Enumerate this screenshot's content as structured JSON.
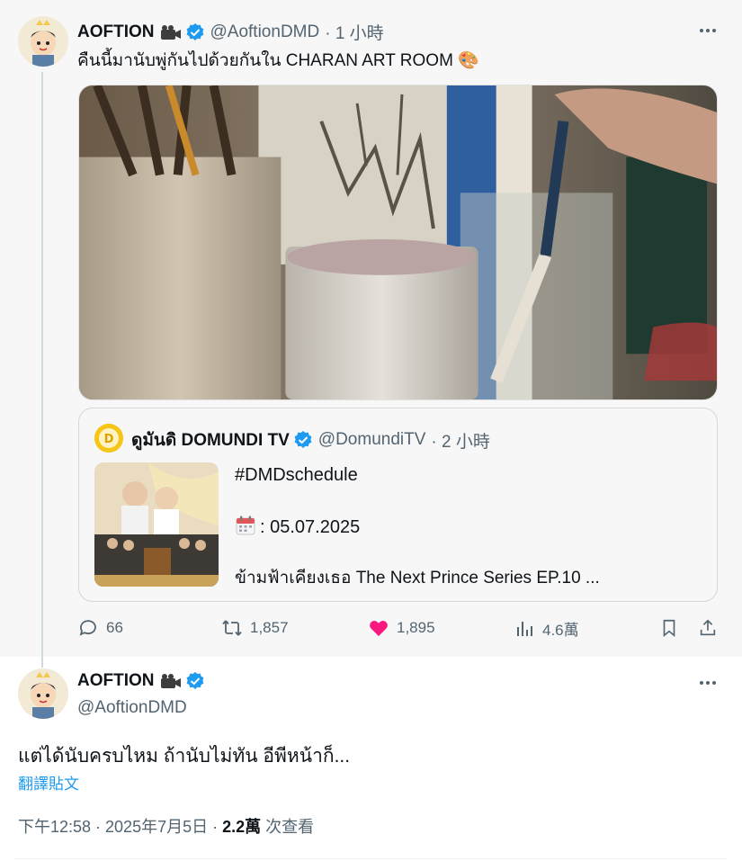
{
  "tweet": {
    "author_name": "AOFTION",
    "author_handle": "@AoftionDMD",
    "time": "· 1 小時",
    "text": "คืนนี้มานับพู่กันไปด้วยกันใน CHARAN ART ROOM 🎨",
    "quote": {
      "name": "ดูมันดิ DOMUNDI TV",
      "handle": "@DomundiTV",
      "time": "· 2 小時",
      "line1": "#DMDschedule",
      "line2": ": 05.07.2025",
      "line3": "ข้ามฟ้าเคียงเธอ The Next Prince Series EP.10 ..."
    },
    "stats": {
      "replies": "66",
      "retweets": "1,857",
      "likes": "1,895",
      "views": "4.6萬"
    }
  },
  "reply": {
    "author_name": "AOFTION",
    "author_handle": "@AoftionDMD",
    "text": "แต่ได้นับครบไหม ถ้านับไม่ทัน อีพีหน้าก็...",
    "translate_label": "翻譯貼文",
    "timestamp": "下午12:58 · 2025年7月5日 · ",
    "views_count": "2.2萬",
    "views_label": " 次查看"
  },
  "colors": {
    "accent": "#1d9bf0",
    "like": "#f91880",
    "muted": "#536471",
    "text": "#0f1419"
  },
  "icons": [
    "camera-icon",
    "verified-icon",
    "more-icon",
    "reply-icon",
    "retweet-icon",
    "heart-icon",
    "views-icon",
    "bookmark-icon",
    "share-icon",
    "calendar-icon"
  ]
}
